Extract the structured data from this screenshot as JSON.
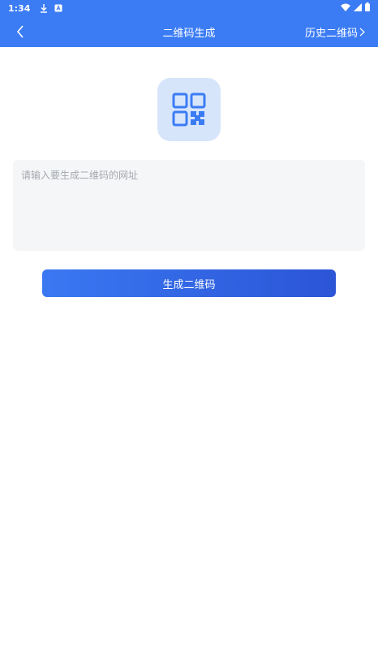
{
  "status_bar": {
    "time": "1:34",
    "icons": [
      "download-icon",
      "a-box-icon",
      "wifi-icon",
      "signal-icon",
      "battery-icon"
    ]
  },
  "app_bar": {
    "title": "二维码生成",
    "history_label": "历史二维码",
    "background": "#3b7cf4"
  },
  "hero": {
    "icon": "qr-code-icon",
    "tile_color": "#d7e5fb"
  },
  "url_input": {
    "placeholder": "请输入要生成二维码的网址",
    "value": ""
  },
  "generate_button": {
    "label": "生成二维码"
  }
}
